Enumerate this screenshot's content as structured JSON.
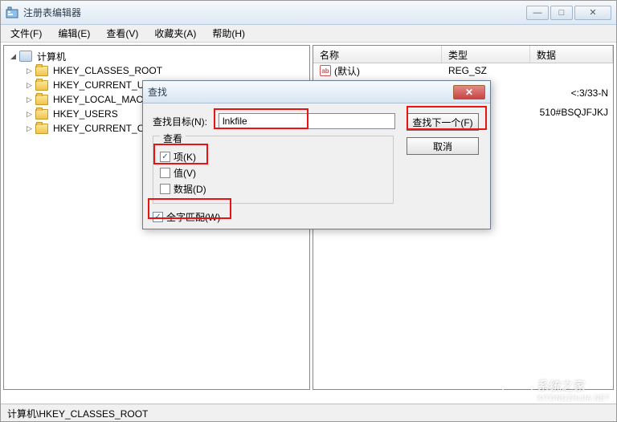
{
  "window": {
    "title": "注册表编辑器",
    "buttons": {
      "min": "—",
      "max": "□",
      "close": "✕"
    }
  },
  "menu": [
    "文件(F)",
    "编辑(E)",
    "查看(V)",
    "收藏夹(A)",
    "帮助(H)"
  ],
  "tree": {
    "root": "计算机",
    "keys": [
      "HKEY_CLASSES_ROOT",
      "HKEY_CURRENT_U",
      "HKEY_LOCAL_MAC",
      "HKEY_USERS",
      "HKEY_CURRENT_C"
    ]
  },
  "list": {
    "headers": {
      "name": "名称",
      "type": "类型",
      "data": "数据"
    },
    "rows": [
      {
        "name": "(默认)",
        "type": "REG_SZ",
        "data": ""
      }
    ],
    "extra_data": [
      "<:3/33-N",
      "510#BSQJFJKJ"
    ]
  },
  "statusbar": "计算机\\HKEY_CLASSES_ROOT",
  "dialog": {
    "title": "查找",
    "close": "✕",
    "target_label": "查找目标(N):",
    "target_value": "lnkfile",
    "look_at_label": "查看",
    "checks": {
      "keys": {
        "label": "项(K)",
        "checked": true
      },
      "values": {
        "label": "值(V)",
        "checked": false
      },
      "data": {
        "label": "数据(D)",
        "checked": false
      }
    },
    "whole_match": {
      "label": "全字匹配(W)",
      "checked": true
    },
    "find_next": "查找下一个(F)",
    "cancel": "取消"
  },
  "watermark": {
    "main": "系统之家",
    "sub": "XITONGZHIJIA.NET"
  }
}
